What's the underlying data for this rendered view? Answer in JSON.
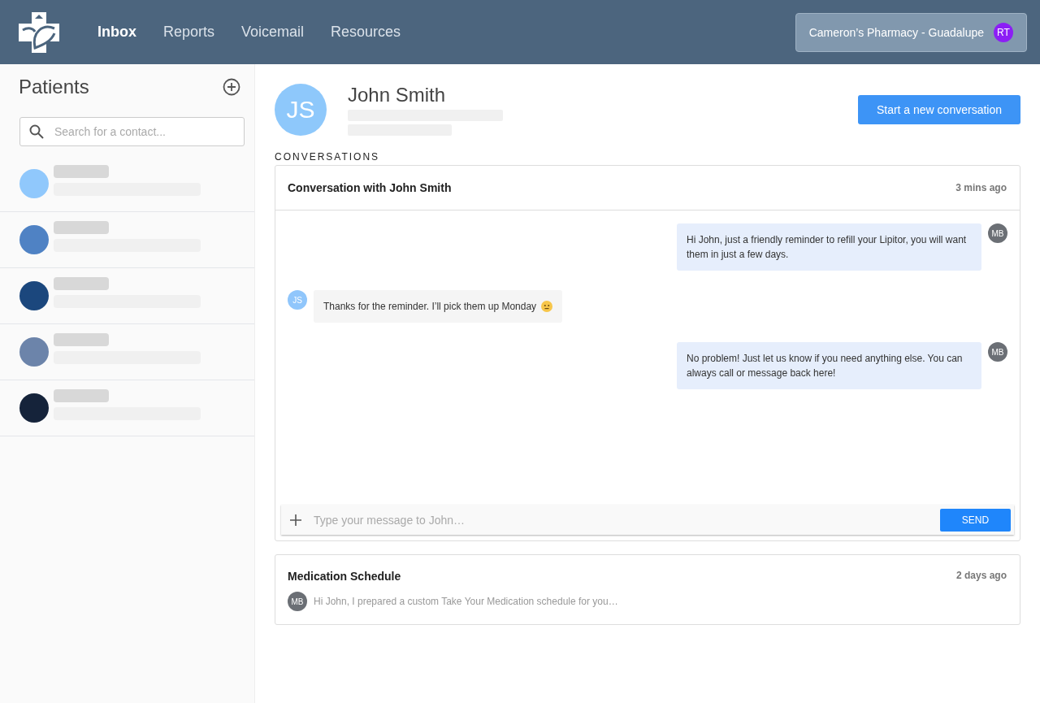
{
  "nav": {
    "items": [
      {
        "label": "Inbox",
        "selected": true
      },
      {
        "label": "Reports",
        "selected": false
      },
      {
        "label": "Voicemail",
        "selected": false
      },
      {
        "label": "Resources",
        "selected": false
      }
    ],
    "account": {
      "name": "Cameron’s Pharmacy - Guadalupe",
      "initials": "RT"
    }
  },
  "sidebar": {
    "title": "Patients",
    "search": {
      "placeholder": "Search for a contact..."
    },
    "patients": [
      {
        "color": "#90c8fc"
      },
      {
        "color": "#4f82c4"
      },
      {
        "color": "#1b477d"
      },
      {
        "color": "#6c84aa"
      },
      {
        "color": "#15233a"
      }
    ]
  },
  "contact": {
    "initials": "JS",
    "name": "John Smith",
    "new_conversation_button": "Start a new conversation"
  },
  "conversations_heading": "CONVERSATIONS",
  "conversations": [
    {
      "kind": "open",
      "title": "Conversation with John Smith",
      "time": "3 mins ago",
      "messages": [
        {
          "kind": "outgoing",
          "initials": "MB",
          "text": "Hi John, just a friendly reminder to refill your Lipitor, you will want them in just a few days.",
          "emoji": false
        },
        {
          "kind": "incoming",
          "initials": "JS",
          "text": "Thanks for the reminder. I’ll pick them up Monday",
          "emoji": true
        },
        {
          "kind": "outgoing",
          "initials": "MB",
          "text": "No problem! Just let us know if you need anything else. You can always call or message back here!",
          "emoji": false
        }
      ],
      "composer": {
        "placeholder": "Type your message to John…",
        "send": "SEND"
      }
    },
    {
      "kind": "collapsed",
      "title": "Medication Schedule",
      "time": "2 days ago",
      "initials": "MB",
      "preview": "Hi John, I prepared a custom Take Your Medication schedule for you…"
    }
  ]
}
